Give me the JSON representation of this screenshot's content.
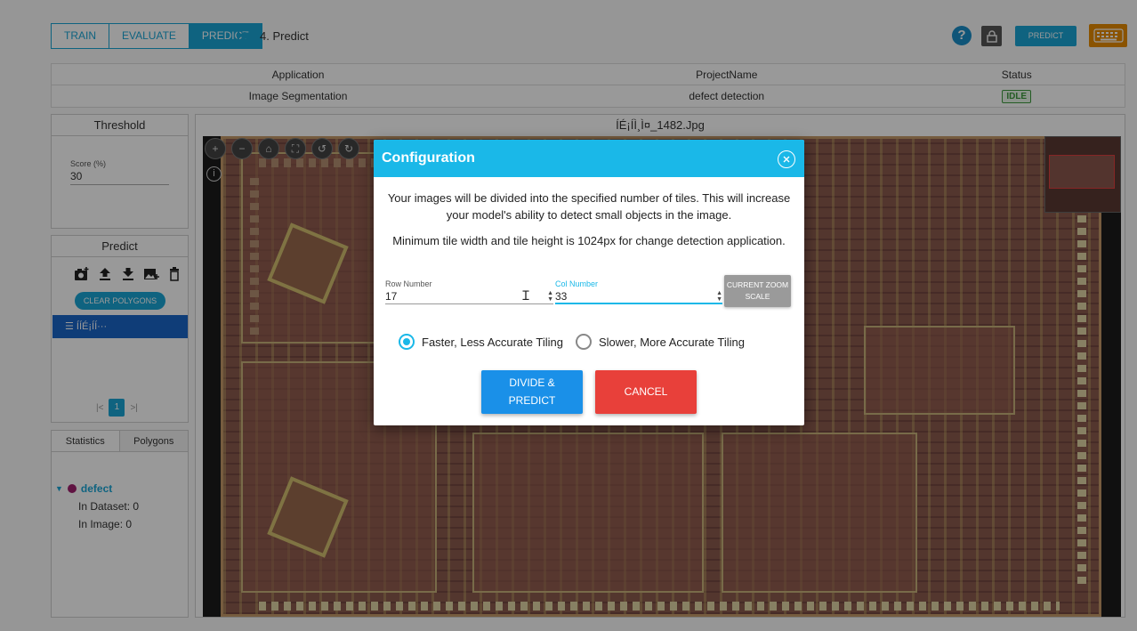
{
  "header": {
    "tabs": [
      {
        "label": "TRAIN",
        "active": false
      },
      {
        "label": "EVALUATE",
        "active": false
      },
      {
        "label": "PREDICT",
        "active": true
      }
    ],
    "step_label": "4. Predict",
    "help_label": "?",
    "predict_button": "PREDICT"
  },
  "info_table": {
    "headers": [
      "Application",
      "ProjectName",
      "Status"
    ],
    "row": {
      "application": "Image Segmentation",
      "project": "defect detection",
      "status": "IDLE"
    }
  },
  "threshold": {
    "title": "Threshold",
    "score_label": "Score (%)",
    "score_value": "30"
  },
  "predict_panel": {
    "title": "Predict",
    "clear_button": "CLEAR POLYGONS",
    "selected_item": "ÍÍÉ¡ÍÍ···",
    "page": "1",
    "first_glyph": "|<",
    "last_glyph": ">|"
  },
  "stats": {
    "tabs": [
      "Statistics",
      "Polygons"
    ],
    "class_name": "defect",
    "in_dataset": "In Dataset: 0",
    "in_image": "In Image: 0"
  },
  "viewer": {
    "filename": "ÍÉ¡ÍÌ¸Ì¤_1482.Jpg"
  },
  "modal": {
    "title": "Configuration",
    "description": "Your images will be divided into the specified number of tiles. This will increase your model's ability to detect small objects in the image.",
    "note": "Minimum tile width and tile height is 1024px for change detection application.",
    "row_label": "Row Number",
    "row_value": "17",
    "col_label": "Col Number",
    "col_value": "33",
    "zoom_line1": "CURRENT ZOOM",
    "zoom_line2": "SCALE",
    "option_fast": "Faster, Less Accurate Tiling",
    "option_slow": "Slower, More Accurate Tiling",
    "selected_option": "fast",
    "divide_line1": "DIVIDE &",
    "divide_line2": "PREDICT",
    "cancel_label": "CANCEL"
  },
  "colors": {
    "accent": "#1aa6d6",
    "modal_header": "#1ab8e8",
    "divide_button": "#1a90e8",
    "cancel_button": "#e8403a",
    "idle_green": "#3c9a3c",
    "keyboard_orange": "#e68a00"
  }
}
